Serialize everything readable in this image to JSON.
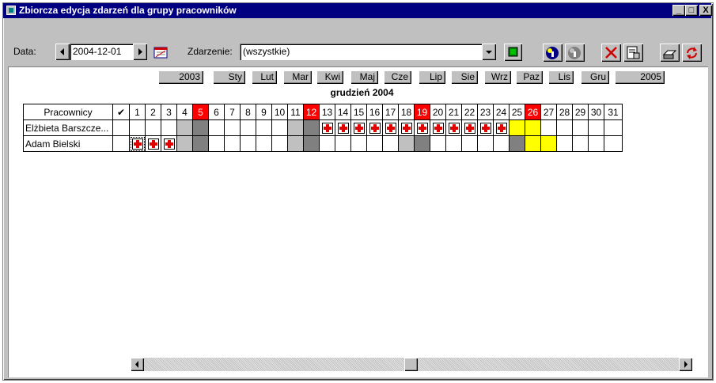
{
  "window": {
    "title": "Zbiorcza edycja zdarzeń dla grupy pracowników",
    "controls": [
      "_",
      "□",
      "X"
    ]
  },
  "toolbar": {
    "date_label": "Data:",
    "date_value": "2004-12-01",
    "event_label": "Zdarzenie:",
    "event_value": "(wszystkie)"
  },
  "nav": {
    "prev_year": "2003",
    "months": [
      "Sty",
      "Lut",
      "Mar",
      "Kwi",
      "Maj",
      "Cze",
      "Lip",
      "Sie",
      "Wrz",
      "Paz",
      "Lis",
      "Gru"
    ],
    "next_year": "2005"
  },
  "calendar": {
    "caption": "grudzień 2004",
    "header_name": "Pracownicy",
    "header_check": "✔",
    "days": [
      "1",
      "2",
      "3",
      "4",
      "5",
      "6",
      "7",
      "8",
      "9",
      "10",
      "11",
      "12",
      "13",
      "14",
      "15",
      "16",
      "17",
      "18",
      "19",
      "20",
      "21",
      "22",
      "23",
      "24",
      "25",
      "26",
      "27",
      "28",
      "29",
      "30",
      "31"
    ],
    "employees": [
      {
        "name": "Elżbieta Barszcze..."
      },
      {
        "name": "Adam Bielski"
      }
    ]
  },
  "colors": {
    "titlebar": "#000080",
    "sunday": "#ff0000",
    "saturday": "#c0c0c0",
    "holiday": "#808080",
    "highlight": "#ffff00",
    "cross": "#e00000"
  },
  "icons": [
    "app-icon",
    "calendar-icon",
    "add-event-icon",
    "info-icon",
    "info-disabled-icon",
    "delete-icon",
    "properties-icon",
    "print-icon",
    "refresh-icon",
    "scroll-left-icon",
    "scroll-right-icon"
  ]
}
